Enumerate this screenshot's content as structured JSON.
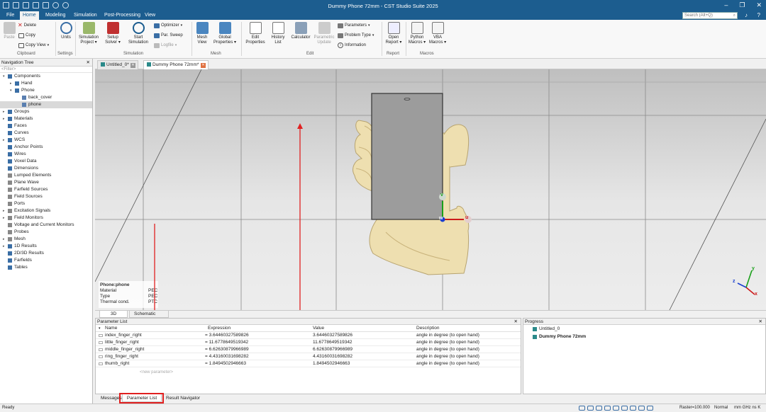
{
  "app": {
    "title": "Dummy Phone 72mm - CST Studio Suite 2025"
  },
  "menu": {
    "tabs": [
      "File",
      "Home",
      "Modeling",
      "Simulation",
      "Post-Processing",
      "View"
    ],
    "active": "Home",
    "search_placeholder": "Search (Alt+Q)"
  },
  "ribbon": {
    "clipboard": {
      "group": "Clipboard",
      "paste": "Paste",
      "delete": "Delete",
      "copy": "Copy",
      "copy_view": "Copy View"
    },
    "settings": {
      "group": "Settings",
      "units": "Units"
    },
    "simulation": {
      "group": "Simulation",
      "simulation_project": [
        "Simulation",
        "Project"
      ],
      "setup_solver": [
        "Setup",
        "Solver"
      ],
      "start_simulation": [
        "Start",
        "Simulation"
      ],
      "optimizer": "Optimizer",
      "par_sweep": "Par. Sweep",
      "logfile": "Logfile"
    },
    "mesh": {
      "group": "Mesh",
      "mesh_view": [
        "Mesh",
        "View"
      ],
      "global_properties": [
        "Global",
        "Properties"
      ]
    },
    "edit": {
      "group": "Edit",
      "edit_properties": [
        "Edit",
        "Properties"
      ],
      "history_list": [
        "History",
        "List"
      ],
      "calculator": "Calculator",
      "parametric_update": [
        "Parametric",
        "Update"
      ],
      "parameters": "Parameters",
      "problem_type": "Problem Type",
      "information": "Information"
    },
    "report": {
      "group": "Report",
      "open_report": [
        "Open",
        "Report"
      ]
    },
    "macros": {
      "group": "Macros",
      "python": [
        "Python",
        "Macros"
      ],
      "vba": [
        "VBA",
        "Macros"
      ]
    }
  },
  "nav": {
    "title": "Navigation Tree",
    "filter": "<Filter>",
    "items": [
      {
        "label": "Components",
        "level": 0,
        "expand": "▾",
        "color": "#3a6ea5"
      },
      {
        "label": "Hand",
        "level": 1,
        "expand": "▸",
        "color": "#3a6ea5"
      },
      {
        "label": "Phone",
        "level": 1,
        "expand": "▾",
        "color": "#3a6ea5"
      },
      {
        "label": "back_cover",
        "level": 2,
        "expand": "",
        "color": "#5a7fb0"
      },
      {
        "label": "phone",
        "level": 2,
        "expand": "",
        "color": "#5a7fb0",
        "selected": true
      },
      {
        "label": "Groups",
        "level": 0,
        "expand": "▸",
        "color": "#3a6ea5"
      },
      {
        "label": "Materials",
        "level": 0,
        "expand": "▸",
        "color": "#3a6ea5"
      },
      {
        "label": "Faces",
        "level": 0,
        "expand": "",
        "color": "#3a6ea5"
      },
      {
        "label": "Curves",
        "level": 0,
        "expand": "",
        "color": "#3a6ea5"
      },
      {
        "label": "WCS",
        "level": 0,
        "expand": "▸",
        "color": "#3a6ea5"
      },
      {
        "label": "Anchor Points",
        "level": 0,
        "expand": "",
        "color": "#3a6ea5"
      },
      {
        "label": "Wires",
        "level": 0,
        "expand": "",
        "color": "#3a6ea5"
      },
      {
        "label": "Voxel Data",
        "level": 0,
        "expand": "",
        "color": "#3a6ea5"
      },
      {
        "label": "Dimensions",
        "level": 0,
        "expand": "",
        "color": "#3a6ea5"
      },
      {
        "label": "Lumped Elements",
        "level": 0,
        "expand": "",
        "color": "#888"
      },
      {
        "label": "Plane Wave",
        "level": 0,
        "expand": "",
        "color": "#888"
      },
      {
        "label": "Farfield Sources",
        "level": 0,
        "expand": "",
        "color": "#888"
      },
      {
        "label": "Field Sources",
        "level": 0,
        "expand": "",
        "color": "#888"
      },
      {
        "label": "Ports",
        "level": 0,
        "expand": "",
        "color": "#888"
      },
      {
        "label": "Excitation Signals",
        "level": 0,
        "expand": "▸",
        "color": "#888"
      },
      {
        "label": "Field Monitors",
        "level": 0,
        "expand": "▸",
        "color": "#888"
      },
      {
        "label": "Voltage and Current Monitors",
        "level": 0,
        "expand": "",
        "color": "#888"
      },
      {
        "label": "Probes",
        "level": 0,
        "expand": "",
        "color": "#888"
      },
      {
        "label": "Mesh",
        "level": 0,
        "expand": "▸",
        "color": "#888"
      },
      {
        "label": "1D Results",
        "level": 0,
        "expand": "▸",
        "color": "#3a6ea5"
      },
      {
        "label": "2D/3D Results",
        "level": 0,
        "expand": "",
        "color": "#3a6ea5"
      },
      {
        "label": "Farfields",
        "level": 0,
        "expand": "",
        "color": "#3a6ea5"
      },
      {
        "label": "Tables",
        "level": 0,
        "expand": "",
        "color": "#3a6ea5"
      }
    ]
  },
  "doc_tabs": [
    {
      "label": "Untitled_0*",
      "active": false
    },
    {
      "label": "Dummy Phone 72mm*",
      "active": true
    }
  ],
  "info_box": {
    "title": "Phone:phone",
    "rows": [
      {
        "key": "Material",
        "value": "PEC"
      },
      {
        "key": "Type",
        "value": "PEC"
      },
      {
        "key": "Thermal cond.",
        "value": "PTC"
      }
    ]
  },
  "axes": {
    "u": "u",
    "v": "v",
    "w": "w",
    "x": "x",
    "y": "y",
    "z": "z"
  },
  "view_tabs": [
    "3D",
    "Schematic"
  ],
  "parameter_list": {
    "title": "Parameter List",
    "columns": [
      "Name",
      "Expression",
      "Value",
      "Description"
    ],
    "rows": [
      {
        "name": "index_finger_right",
        "expression": "= 3.64460327589826",
        "value": "3.64460327589826",
        "description": "angle in degree (to open hand)"
      },
      {
        "name": "little_finger_right",
        "expression": "= 11.6778649519342",
        "value": "11.6778649519342",
        "description": "angle in degree (to open hand)"
      },
      {
        "name": "middle_finger_right",
        "expression": "= 6.62630879966989",
        "value": "6.62630879966989",
        "description": "angle in degree (to open hand)"
      },
      {
        "name": "ring_finger_right",
        "expression": "= 4.43160031698282",
        "value": "4.43160031698282",
        "description": "angle in degree (to open hand)"
      },
      {
        "name": "thumb_right",
        "expression": "= 1.8494502946663",
        "value": "1.8494502946663",
        "description": "angle in degree (to open hand)"
      }
    ],
    "new_row": "<new parameter>"
  },
  "progress": {
    "title": "Progress",
    "items": [
      {
        "label": "Untitled_0",
        "bold": false
      },
      {
        "label": "Dummy Phone 72mm",
        "bold": true
      }
    ]
  },
  "bottom_tabs": [
    "Messages",
    "Parameter List",
    "Result Navigator"
  ],
  "status": {
    "left": "Ready",
    "raster": "Raster=100.000",
    "mode": "Normal",
    "units": "mm  GHz  ns  K"
  }
}
